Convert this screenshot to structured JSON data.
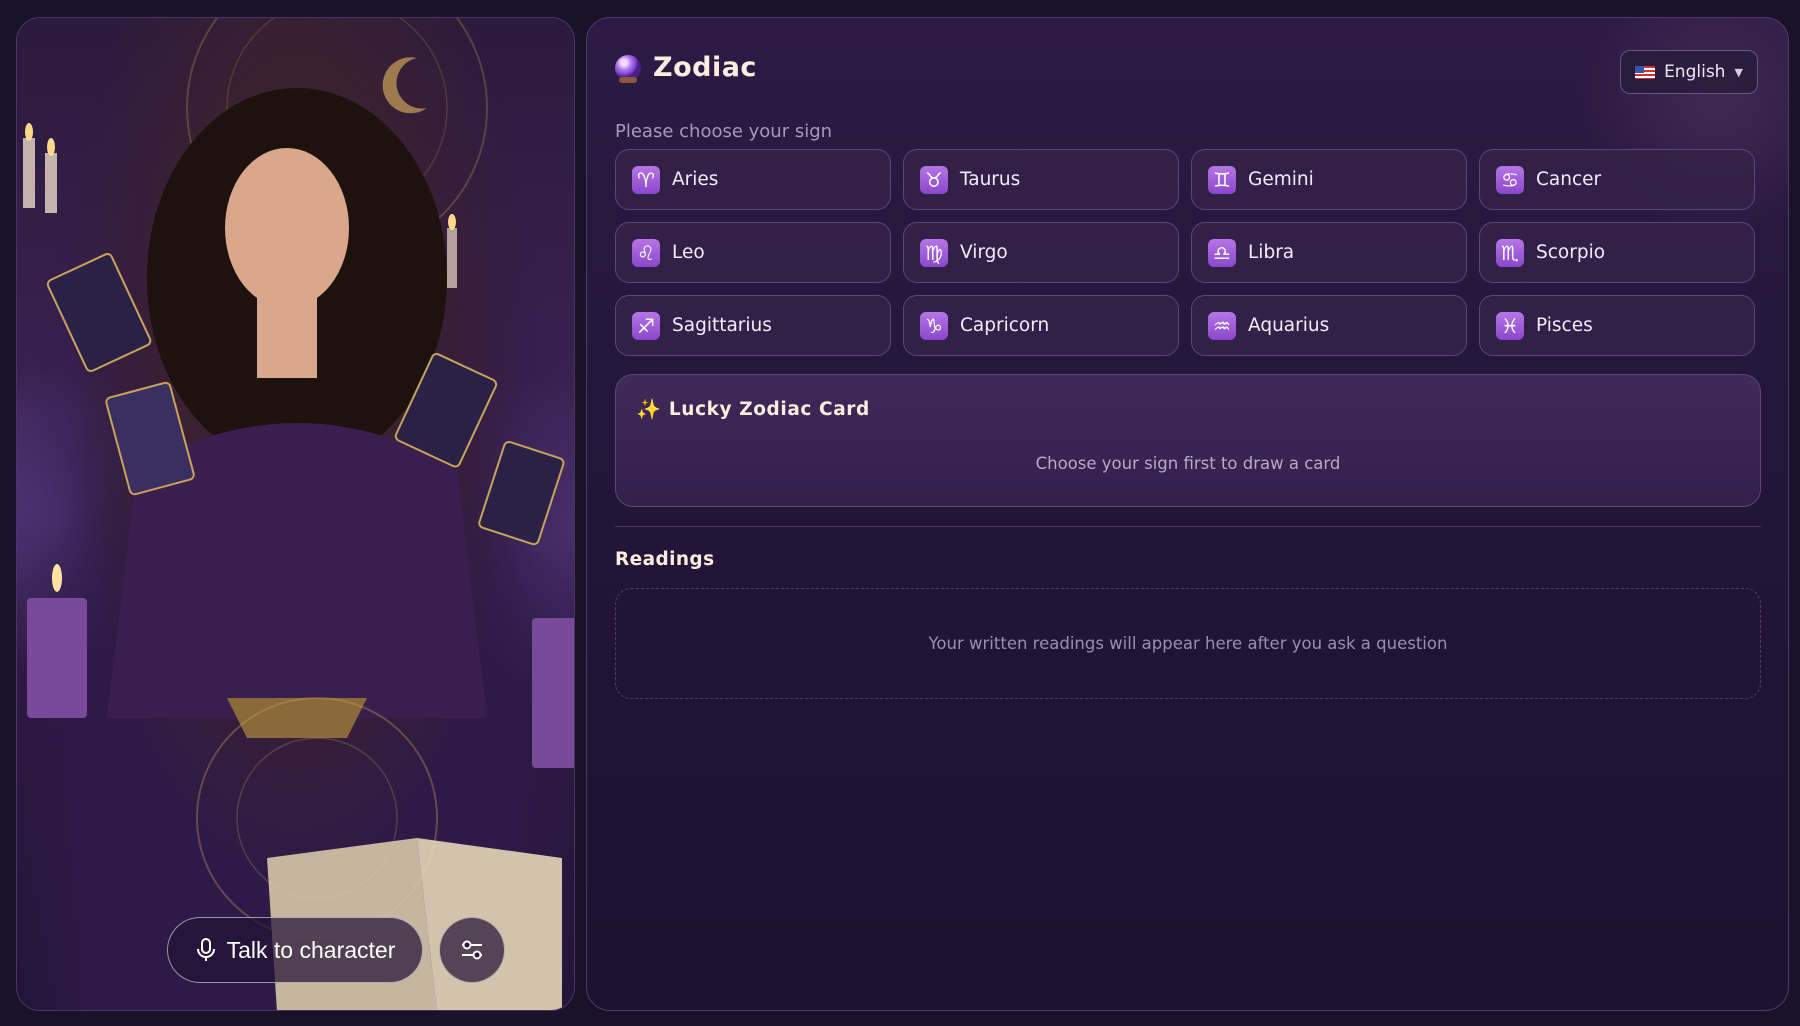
{
  "character": {
    "talk_label": "Talk to character"
  },
  "panel": {
    "title": "Zodiac",
    "subtitle": "Please choose your sign",
    "language": {
      "selected": "English"
    }
  },
  "signs": [
    {
      "label": "Aries",
      "glyph": "♈"
    },
    {
      "label": "Taurus",
      "glyph": "♉"
    },
    {
      "label": "Gemini",
      "glyph": "♊"
    },
    {
      "label": "Cancer",
      "glyph": "♋"
    },
    {
      "label": "Leo",
      "glyph": "♌"
    },
    {
      "label": "Virgo",
      "glyph": "♍"
    },
    {
      "label": "Libra",
      "glyph": "♎"
    },
    {
      "label": "Scorpio",
      "glyph": "♏"
    },
    {
      "label": "Sagittarius",
      "glyph": "♐"
    },
    {
      "label": "Capricorn",
      "glyph": "♑"
    },
    {
      "label": "Aquarius",
      "glyph": "♒"
    },
    {
      "label": "Pisces",
      "glyph": "♓"
    }
  ],
  "lucky_card": {
    "icon": "✨",
    "title": "Lucky Zodiac Card",
    "hint": "Choose your sign first to draw a card"
  },
  "readings": {
    "title": "Readings",
    "empty_text": "Your written readings will appear here after you ask a question"
  },
  "colors": {
    "accent": "#9a58d8",
    "background": "#1a1228",
    "title_text": "#fbeede"
  }
}
